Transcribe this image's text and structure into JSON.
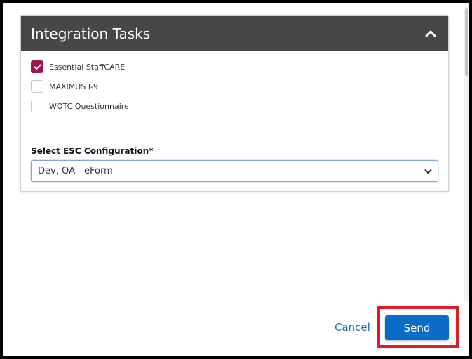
{
  "panel": {
    "title": "Integration Tasks",
    "collapse_icon": "chevron-up-icon"
  },
  "tasks": [
    {
      "label": "Essential StaffCARE",
      "checked": true
    },
    {
      "label": "MAXIMUS I-9",
      "checked": false
    },
    {
      "label": "WOTC Questionnaire",
      "checked": false
    }
  ],
  "esc_config": {
    "label": "Select ESC Configuration*",
    "selected": "Dev, QA - eForm",
    "dropdown_icon": "chevron-down-icon"
  },
  "footer": {
    "cancel_label": "Cancel",
    "send_label": "Send"
  },
  "colors": {
    "header_bg": "#474747",
    "checkbox_checked": "#a0144f",
    "primary_button": "#0a6cc6",
    "link": "#1f6fbf",
    "highlight_border": "#e01b22"
  }
}
